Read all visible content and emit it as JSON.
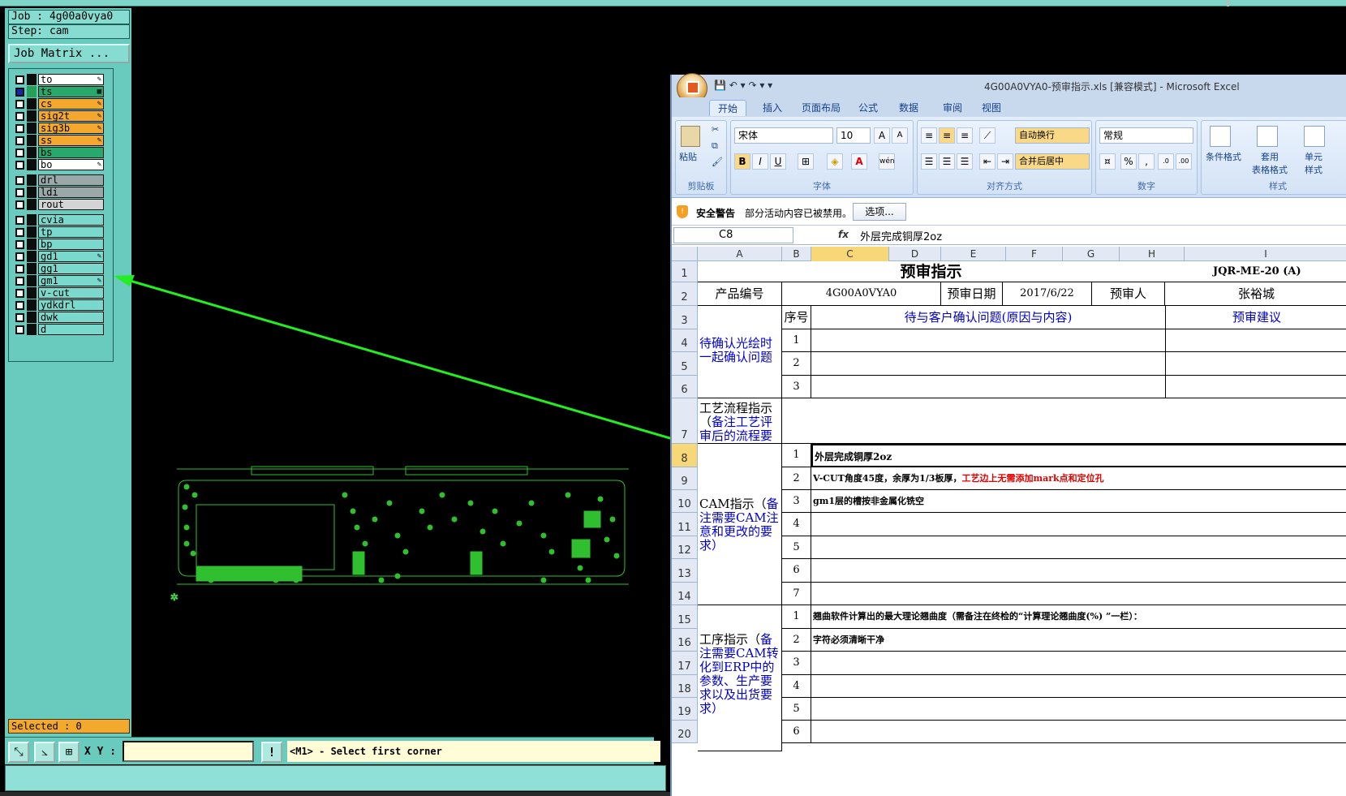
{
  "cam": {
    "job_label": "Job : 4g00a0vya0",
    "step_label": "Step: cam",
    "job_matrix_button": "Job Matrix ...",
    "layers_group1": [
      {
        "name": "to",
        "color": "#ffffff",
        "edit": "✎",
        "selected": false
      },
      {
        "name": "ts",
        "color": "#28a86b",
        "edit": "▦",
        "selected": true
      },
      {
        "name": "cs",
        "color": "#f4a82e",
        "edit": "✎",
        "selected": false
      },
      {
        "name": "sig2t",
        "color": "#f4a82e",
        "edit": "✎",
        "selected": false
      },
      {
        "name": "sig3b",
        "color": "#f4a82e",
        "edit": "✎",
        "selected": false
      },
      {
        "name": "ss",
        "color": "#f4a82e",
        "edit": "✎",
        "selected": false
      },
      {
        "name": "bs",
        "color": "#28a86b",
        "edit": "",
        "selected": false
      },
      {
        "name": "bo",
        "color": "#ffffff",
        "edit": "✎",
        "selected": false
      }
    ],
    "layers_group2": [
      {
        "name": "drl",
        "color": "#9aa8a8"
      },
      {
        "name": "ldi",
        "color": "#9aa8a8"
      },
      {
        "name": "rout",
        "color": "#d4d4d4"
      }
    ],
    "layers_group3": [
      {
        "name": "cvia",
        "edit": ""
      },
      {
        "name": "tp",
        "edit": ""
      },
      {
        "name": "bp",
        "edit": ""
      },
      {
        "name": "gd1",
        "edit": "✎"
      },
      {
        "name": "gg1",
        "edit": ""
      },
      {
        "name": "gm1",
        "edit": "✎"
      },
      {
        "name": "v-cut",
        "edit": ""
      },
      {
        "name": "ydkdrl",
        "edit": ""
      },
      {
        "name": "dwk",
        "edit": ""
      },
      {
        "name": "d",
        "edit": ""
      }
    ],
    "selected_label": "Selected : 0",
    "xy_label": "X Y :",
    "xy_value": "",
    "message": "<M1> - Select first corner",
    "pcb_color": "#2fbf2f",
    "arrow_color": "#22ee22"
  },
  "excel": {
    "title": "4G00A0VYA0-预审指示.xls  [兼容模式] - Microsoft Excel",
    "tabs": [
      "开始",
      "插入",
      "页面布局",
      "公式",
      "数据",
      "审阅",
      "视图"
    ],
    "ribbon": {
      "paste": "粘贴",
      "clipboard": "剪贴板",
      "font_name": "宋体",
      "font_size": "10",
      "font_group": "字体",
      "wrap": "自动换行",
      "merge": "合并后居中",
      "align_group": "对齐方式",
      "number_format": "常规",
      "number_group": "数字",
      "cond_format": "条件格式",
      "table_format": "套用\n表格格式",
      "cell_styles": "单元\n样式",
      "styles_group": "样式"
    },
    "security": {
      "title": "安全警告",
      "text": "部分活动内容已被禁用。",
      "button": "选项..."
    },
    "name_box": "C8",
    "formula": "外层完成铜厚2oz",
    "columns": [
      "A",
      "B",
      "C",
      "D",
      "E",
      "F",
      "G",
      "H",
      "I"
    ],
    "rows": [
      "1",
      "2",
      "3",
      "4",
      "5",
      "6",
      "7",
      "8",
      "9",
      "10",
      "11",
      "12",
      "13",
      "14",
      "15",
      "16",
      "17",
      "18",
      "19",
      "20"
    ],
    "sheet": {
      "title": "预审指示",
      "doc_no": "JQR-ME-20 (A)",
      "product_label": "产品编号",
      "product_value": "4G00A0VYA0",
      "date_label": "预审日期",
      "date_value": "2017/6/22",
      "reviewer_label": "预审人",
      "reviewer_value": "张裕城",
      "confirm_label": "待确认光绘时一起确认问题",
      "seq_label": "序号",
      "issue_header": "待与客户确认问题(原因与内容)",
      "advice_header": "预审建议",
      "process_label_a": "工艺流程指示（",
      "process_label_b": "备注工艺评审后的流程要求）",
      "cam_label_a": "CAM指示（",
      "cam_label_b": "备注需要CAM注意和更改的要求）",
      "cam_items": [
        "外层完成铜厚2oz",
        "V-CUT角度45度，余厚为1/3板厚，",
        "gm1层的槽按非金属化铣空",
        "",
        "",
        "",
        ""
      ],
      "cam_item2_red": "工艺边上无需添加mark点和定位孔",
      "work_label_a": "工序指示（",
      "work_label_b": "备注需要CAM转化到ERP中的参数、生产要求以及出货要求）",
      "work_items": [
        "翘曲软件计算出的最大理论翘曲度（需备注在终检的“计算理论翘曲度(%) ”一栏）：",
        "字符必须清晰干净",
        "",
        "",
        "",
        ""
      ]
    }
  }
}
